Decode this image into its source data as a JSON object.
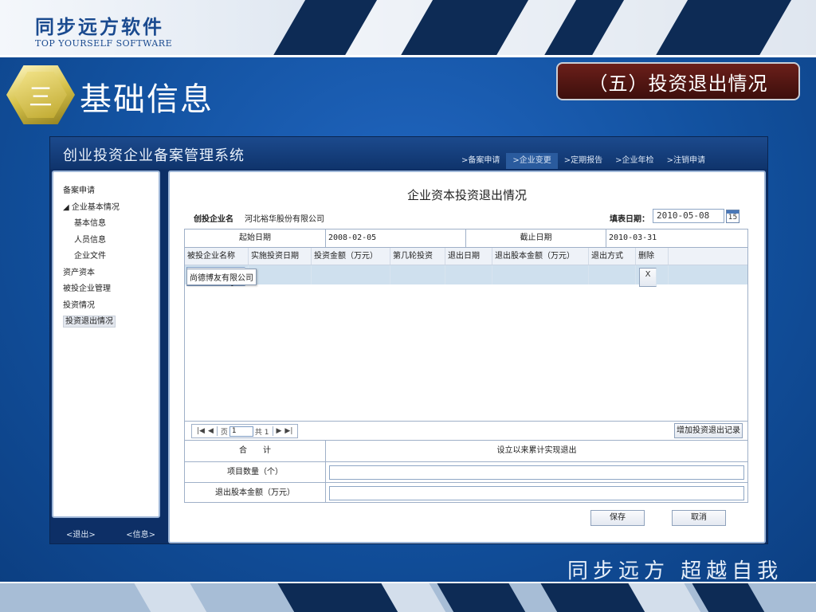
{
  "slide": {
    "company_cn": "同步远方软件",
    "company_en": "TOP YOURSELF SOFTWARE",
    "section_number": "三",
    "section_title": "基础信息",
    "subsection": "（五）投资退出情况",
    "slogan": "同步远方  超越自我"
  },
  "app": {
    "title": "创业投资企业备案管理系统",
    "nav": [
      {
        "label": ">备案申请",
        "active": false
      },
      {
        "label": ">企业变更",
        "active": true
      },
      {
        "label": ">定期报告",
        "active": false
      },
      {
        "label": ">企业年检",
        "active": false
      },
      {
        "label": ">注销申请",
        "active": false
      }
    ]
  },
  "sidebar": {
    "items": [
      {
        "label": "备案申请"
      },
      {
        "label": "◢ 企业基本情况"
      },
      {
        "label": "基本信息"
      },
      {
        "label": "人员信息"
      },
      {
        "label": "企业文件"
      },
      {
        "label": "资产资本"
      },
      {
        "label": "被投企业管理"
      },
      {
        "label": "投资情况"
      },
      {
        "label": "投资退出情况"
      }
    ],
    "footer_exit": "<退出>",
    "footer_info": "<信息>"
  },
  "form": {
    "title": "企业资本投资退出情况",
    "corp_label": "创投企业名",
    "corp_value": "河北裕华股份有限公司",
    "fill_date_label": "填表日期：",
    "fill_date_value": "2010-05-08",
    "calendar_day": "15",
    "start_date_label": "起始日期",
    "start_date_value": "2008-02-05",
    "end_date_label": "截止日期",
    "end_date_value": "2010-03-31"
  },
  "grid": {
    "columns": [
      "被投企业名称",
      "实施投资日期",
      "投资金额（万元）",
      "第几轮投资",
      "退出日期",
      "退出股本金额（万元）",
      "退出方式",
      "删除"
    ],
    "dropdown_option": "尚德博友有限公司",
    "delete_label": "X"
  },
  "pager": {
    "first": "|◀",
    "prev": "◀",
    "page_label": "页",
    "page_value": "1",
    "total": "共 1",
    "next": "▶",
    "last": "▶|"
  },
  "add_button": "增加投资退出记录",
  "summary": {
    "total_label": "合　　计",
    "total_header": "设立以来累计实现退出",
    "count_label": "项目数量（个）",
    "amount_label": "退出股本金额（万元）"
  },
  "buttons": {
    "save": "保存",
    "cancel": "取消"
  }
}
